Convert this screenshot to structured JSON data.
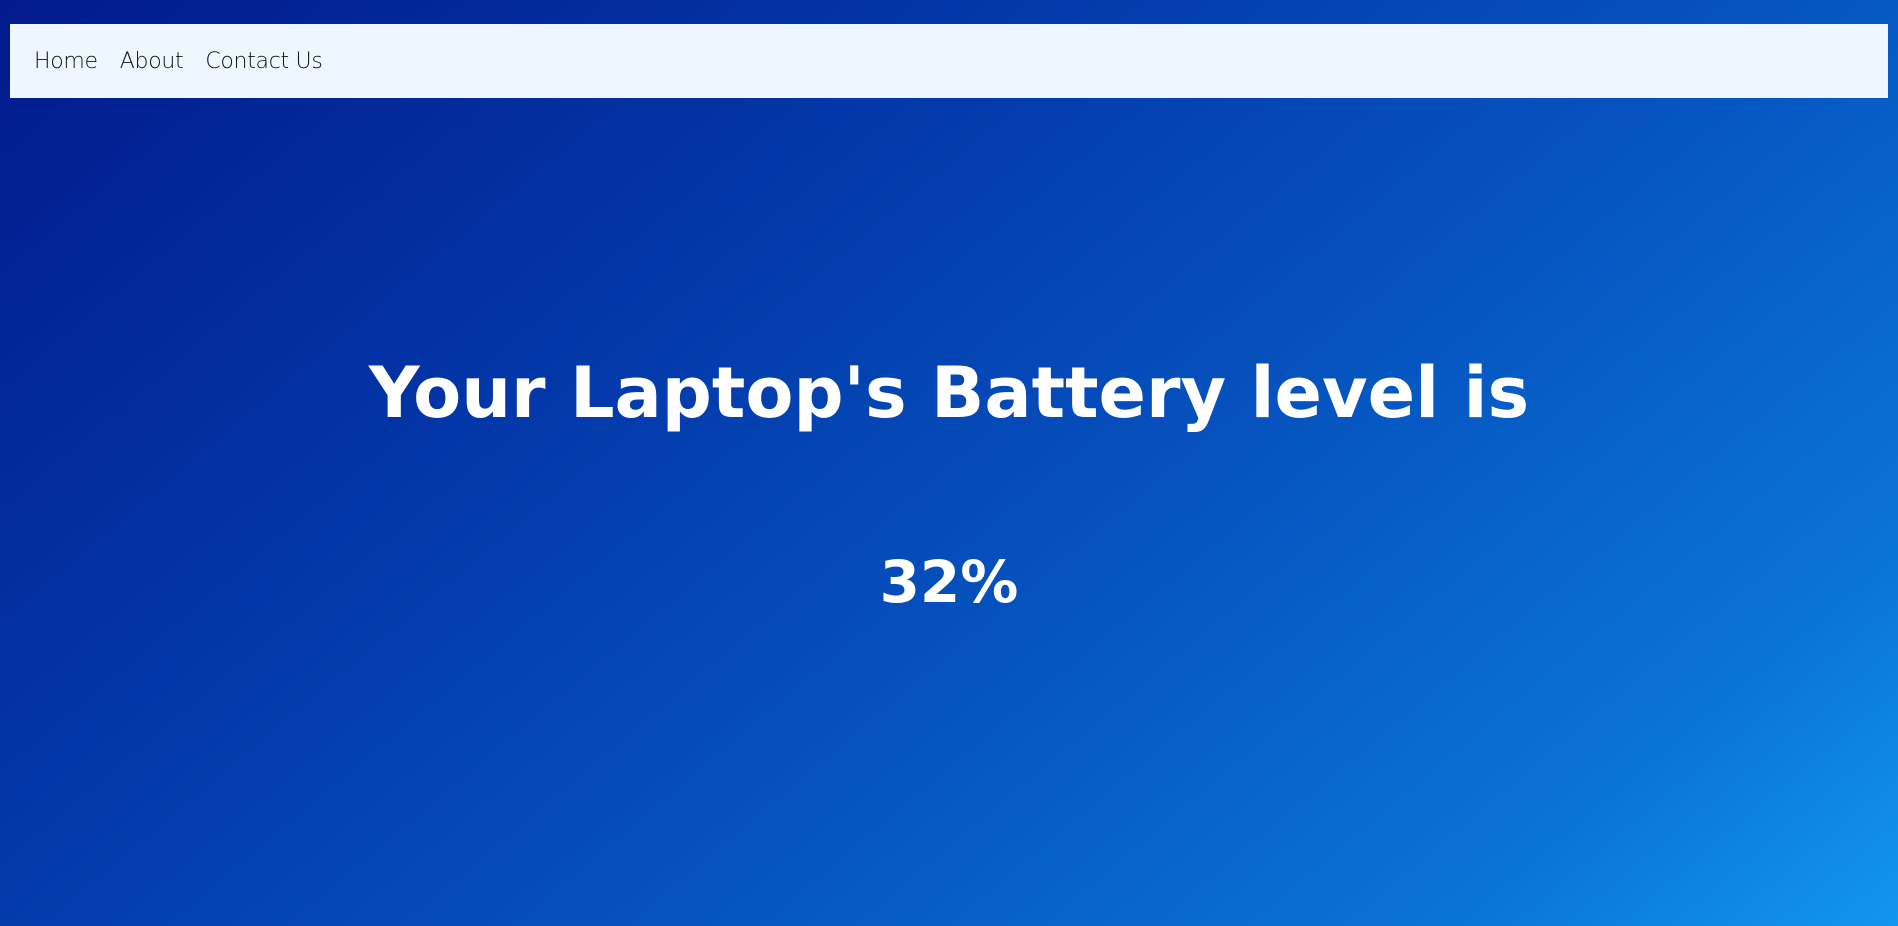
{
  "nav": {
    "items": [
      {
        "label": "Home"
      },
      {
        "label": "About"
      },
      {
        "label": "Contact Us"
      }
    ]
  },
  "main": {
    "heading": "Your Laptop's Battery level is",
    "battery_level": "32%"
  },
  "colors": {
    "nav_background": "#eef6ff",
    "background_start": "#021a8c",
    "background_end": "#1296ee",
    "text": "#ffffff"
  }
}
